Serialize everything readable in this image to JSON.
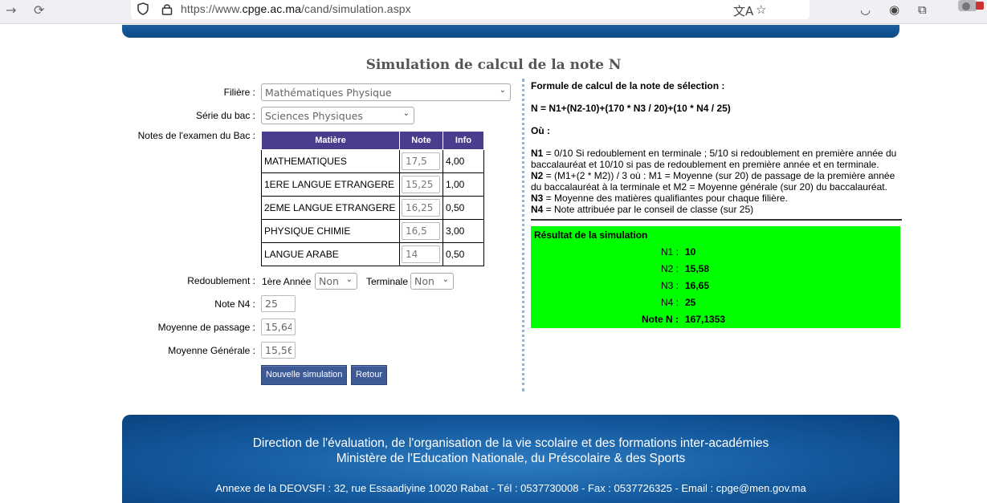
{
  "browser": {
    "url_scheme": "https://www.",
    "url_host": "cpge.ac.ma",
    "url_path": "/cand/simulation.aspx"
  },
  "page": {
    "title": "Simulation de calcul de la note N"
  },
  "form": {
    "filiere_label": "Filière :",
    "filiere_value": "Mathématiques Physique",
    "serie_label": "Série du bac :",
    "serie_value": "Sciences Physiques",
    "notes_label": "Notes de l'examen du Bac :",
    "table_headers": [
      "Matière",
      "Note",
      "Info"
    ],
    "subjects": [
      {
        "matiere": "MATHEMATIQUES",
        "note": "17,5",
        "info": "4,00"
      },
      {
        "matiere": "1ERE LANGUE ETRANGERE",
        "note": "15,25",
        "info": "1,00"
      },
      {
        "matiere": "2EME LANGUE ETRANGERE",
        "note": "16,25",
        "info": "0,50"
      },
      {
        "matiere": "PHYSIQUE CHIMIE",
        "note": "16,5",
        "info": "3,00"
      },
      {
        "matiere": "LANGUE ARABE",
        "note": "14",
        "info": "0,50"
      }
    ],
    "redoublement_label": "Redoublement :",
    "premiere_label": "1ère Année",
    "premiere_value": "Non",
    "terminale_label": "Terminale",
    "terminale_value": "Non",
    "n4_label": "Note N4 :",
    "n4_value": "25",
    "moy_passage_label": "Moyenne de passage :",
    "moy_passage_value": "15,64",
    "moy_generale_label": "Moyenne Générale :",
    "moy_generale_value": "15,56",
    "btn_nouvelle": "Nouvelle simulation",
    "btn_retour": "Retour"
  },
  "formula": {
    "heading": "Formule de calcul de la note de sélection :",
    "equation": "N = N1+(N2-10)+(170 * N3 / 20)+(10 * N4 / 25)",
    "ou": "Où :",
    "n1_key": "N1",
    "n1_text": " = 0/10 Si redoublement en terminale ; 5/10 si redoublement en première année du baccalauréat et 10/10 si pas de redoublement en première année et en terminale.",
    "n2_key": "N2",
    "n2_text": " = (M1+(2 * M2)) / 3 où : M1 = Moyenne (sur 20) de passage de la première année du baccalauréat à la terminale et M2 = Moyenne générale (sur 20) du baccalauréat.",
    "n3_key": "N3",
    "n3_text": " = Moyenne des matières qualifiantes pour chaque filière.",
    "n4_key": "N4",
    "n4_text": " = Note attribuée par le conseil de classe (sur 25)"
  },
  "result": {
    "title": "Résultat de la simulation",
    "rows": [
      {
        "label": "N1 :",
        "value": "10"
      },
      {
        "label": "N2 :",
        "value": "15,58"
      },
      {
        "label": "N3 :",
        "value": "16,65"
      },
      {
        "label": "N4 :",
        "value": "25"
      },
      {
        "label": "Note N :",
        "value": "167,1353"
      }
    ]
  },
  "footer": {
    "line1": "Direction de l'évaluation, de l'organisation de la vie scolaire et des formations inter-académies",
    "line2": "Ministère de l'Education Nationale, du Préscolaire & des Sports",
    "line3": "Annexe de la DEOVSFI : 32, rue Essaadiyine 10020 Rabat - Tél : 0537730008 - Fax : 0537726325 - Email : cpge@men.gov.ma"
  }
}
